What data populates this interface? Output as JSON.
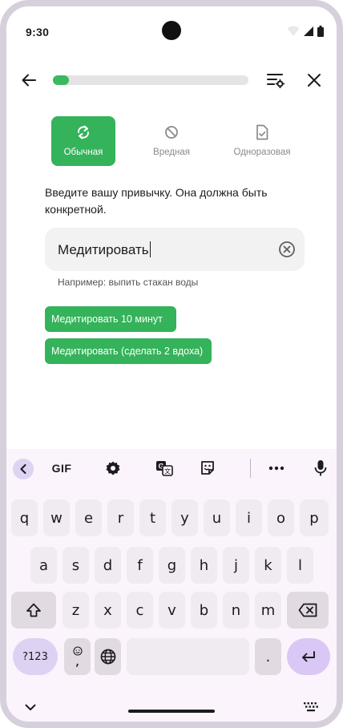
{
  "status_bar": {
    "time": "9:30"
  },
  "app_bar": {
    "back_icon": "arrow-back-icon",
    "progress_fraction": 0.08,
    "progress_color": "#3ab95e",
    "filter_icon": "tune-settings-icon",
    "close_icon": "close-icon"
  },
  "habit_types": [
    {
      "label": "Обычная",
      "icon": "sync-icon",
      "selected": true
    },
    {
      "label": "Вредная",
      "icon": "block-icon",
      "selected": false
    },
    {
      "label": "Одноразовая",
      "icon": "file-check-icon",
      "selected": false
    }
  ],
  "prompt": "Введите вашу привычку. Она должна быть конкретной.",
  "habit_input": {
    "value": "Медитировать",
    "clear_icon": "clear-circle-icon"
  },
  "hint": "Например: выпить стакан воды",
  "suggestions": [
    "Медитировать 10 минут",
    "Медитировать (сделать 2 вдоха)"
  ],
  "accent_color": "#34b35a",
  "keyboard": {
    "toolbar": {
      "collapse_icon": "chevron-left-icon",
      "gif_label": "GIF",
      "settings_icon": "gear-icon",
      "translate_icon": "translate-icon",
      "sticker_icon": "sticker-icon",
      "more_icon": "more-horizontal-icon",
      "mic_icon": "microphone-icon"
    },
    "row1": [
      "q",
      "w",
      "e",
      "r",
      "t",
      "y",
      "u",
      "i",
      "o",
      "p"
    ],
    "row2": [
      "a",
      "s",
      "d",
      "f",
      "g",
      "h",
      "j",
      "k",
      "l"
    ],
    "row3": [
      "z",
      "x",
      "c",
      "v",
      "b",
      "n",
      "m"
    ],
    "shift_icon": "shift-icon",
    "backspace_icon": "backspace-icon",
    "symbols_label": "?123",
    "emoji_comma": ",",
    "period": ".",
    "globe_icon": "globe-icon",
    "enter_icon": "enter-icon"
  },
  "nav_bar": {
    "down_icon": "chevron-down-icon",
    "keyboard_icon": "keyboard-icon"
  }
}
